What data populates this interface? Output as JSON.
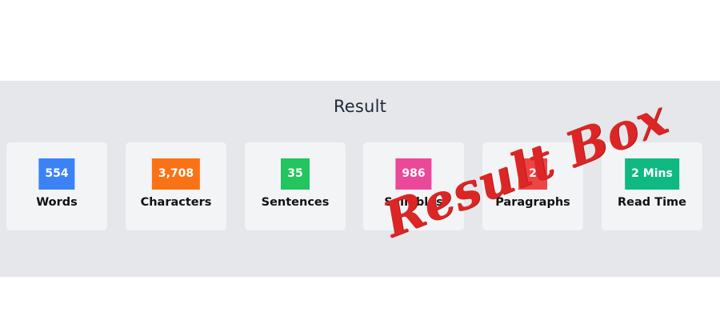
{
  "panel": {
    "title": "Result"
  },
  "stats": [
    {
      "value": "554",
      "label": "Words",
      "color": "#3b82f6"
    },
    {
      "value": "3,708",
      "label": "Characters",
      "color": "#f97316"
    },
    {
      "value": "35",
      "label": "Sentences",
      "color": "#22c55e"
    },
    {
      "value": "986",
      "label": "Syllables",
      "color": "#ec4899"
    },
    {
      "value": "2",
      "label": "Paragraphs",
      "color": "#ef4444"
    },
    {
      "value": "2 Mins",
      "label": "Read Time",
      "color": "#10b981"
    }
  ],
  "overlay": {
    "text": "Result Box",
    "color": "#dc2626"
  }
}
